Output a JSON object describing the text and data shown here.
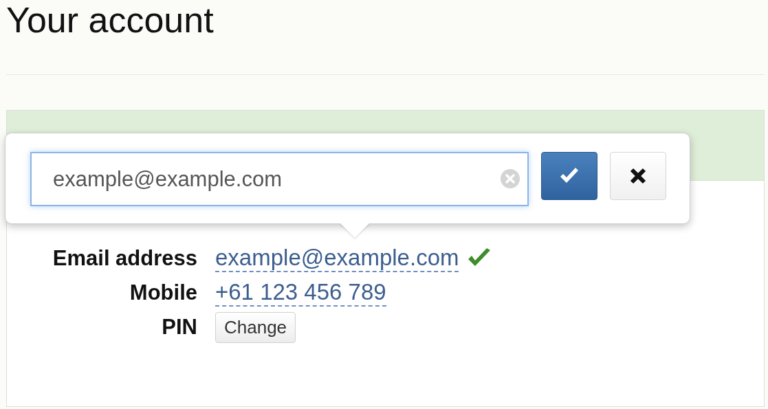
{
  "title": "Your account",
  "popover": {
    "value": "example@example.com"
  },
  "rows": [
    {
      "label": "Email address",
      "value": "example@example.com",
      "kind": "link",
      "verified": true
    },
    {
      "label": "Mobile",
      "value": "+61 123 456 789",
      "kind": "link",
      "verified": false
    },
    {
      "label": "PIN",
      "value": "Change",
      "kind": "button",
      "verified": false
    }
  ]
}
